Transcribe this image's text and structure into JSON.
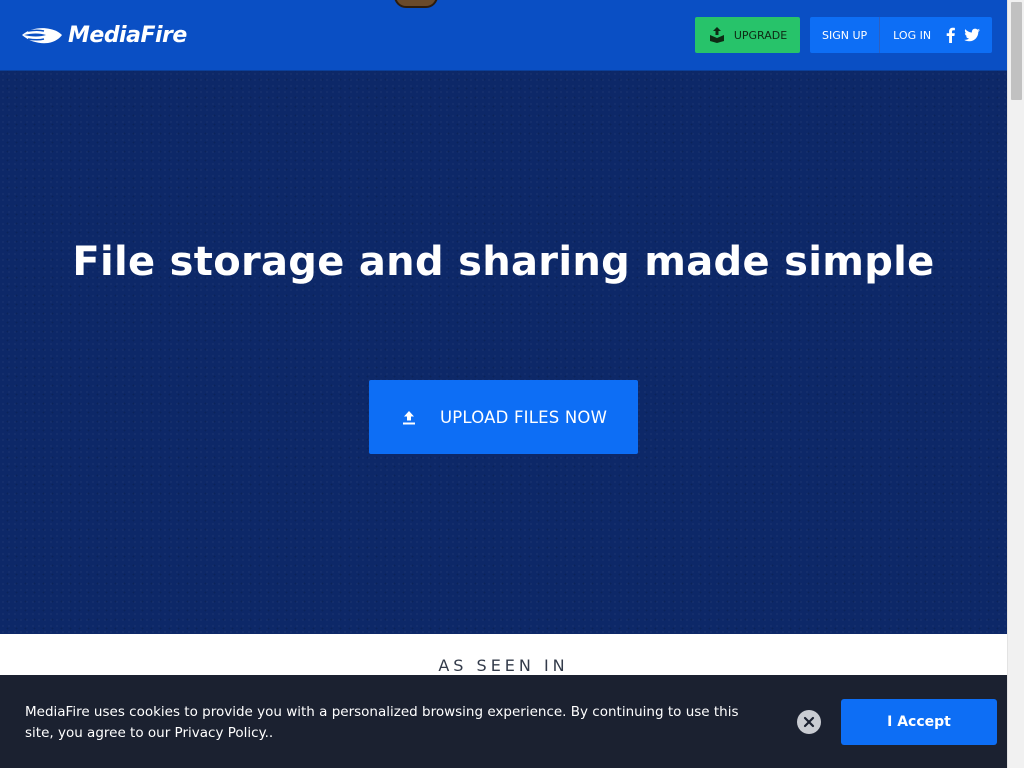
{
  "header": {
    "brand": "MediaFire",
    "upgrade_label": "UPGRADE",
    "signup_label": "SIGN UP",
    "login_label": "LOG IN",
    "social_icons": [
      "facebook-icon",
      "twitter-icon"
    ]
  },
  "hero": {
    "title": "File storage and sharing made simple",
    "upload_label": "UPLOAD FILES NOW"
  },
  "seen_in": {
    "label": "AS SEEN IN"
  },
  "cookie": {
    "message": "MediaFire uses cookies to provide you with a personalized browsing experience. By continuing to use this site, you agree to our Privacy Policy..",
    "accept_label": "I Accept"
  },
  "colors": {
    "header_bg": "#0a4fc4",
    "hero_bg": "#0d2868",
    "primary_button": "#0d6ef5",
    "upgrade_button": "#27c36a",
    "cookie_bg": "#1b2130"
  }
}
